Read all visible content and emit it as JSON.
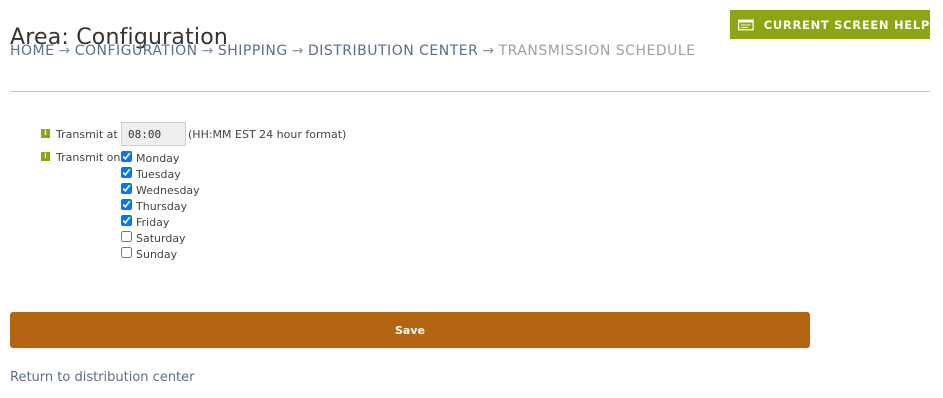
{
  "header": {
    "title": "Area: Configuration",
    "help_button_label": "CURRENT SCREEN HELP",
    "help_icon": "window-icon",
    "accent_color": "#8ca512"
  },
  "breadcrumb": {
    "separator": "→",
    "items": [
      {
        "label": "HOME"
      },
      {
        "label": "CONFIGURATION"
      },
      {
        "label": "SHIPPING"
      },
      {
        "label": "DISTRIBUTION CENTER"
      },
      {
        "label": "TRANSMISSION SCHEDULE"
      }
    ]
  },
  "form": {
    "transmit_at": {
      "label": "Transmit at",
      "value": "08:00",
      "hint": "(HH:MM EST 24 hour format)"
    },
    "transmit_on": {
      "label": "Transmit on",
      "days": [
        {
          "label": "Monday",
          "checked": true
        },
        {
          "label": "Tuesday",
          "checked": true
        },
        {
          "label": "Wednesday",
          "checked": true
        },
        {
          "label": "Thursday",
          "checked": true
        },
        {
          "label": "Friday",
          "checked": true
        },
        {
          "label": "Saturday",
          "checked": false
        },
        {
          "label": "Sunday",
          "checked": false
        }
      ]
    },
    "info_icon_glyph": "i"
  },
  "actions": {
    "save_label": "Save",
    "save_color": "#b56512",
    "return_link": "Return to distribution center"
  }
}
